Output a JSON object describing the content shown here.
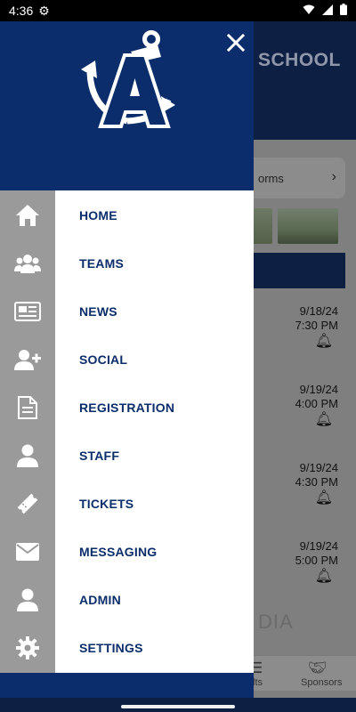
{
  "status_bar": {
    "time": "4:36"
  },
  "background": {
    "school_text": "SCHOOL",
    "forms_text": "orms",
    "events": [
      {
        "date": "9/18/24",
        "time": "7:30 PM"
      },
      {
        "date": "9/19/24",
        "time": "4:00 PM"
      },
      {
        "date": "9/19/24",
        "time": "4:30 PM"
      },
      {
        "date": "9/19/24",
        "time": "5:00 PM"
      }
    ],
    "media_text": "DIA",
    "tab_results_partial": "lts",
    "tab_sponsors": "Sponsors"
  },
  "menu": {
    "items": [
      {
        "label": "HOME",
        "icon": "home-icon"
      },
      {
        "label": "TEAMS",
        "icon": "group-icon"
      },
      {
        "label": "NEWS",
        "icon": "newspaper-icon"
      },
      {
        "label": "SOCIAL",
        "icon": "add-user-icon"
      },
      {
        "label": "REGISTRATION",
        "icon": "document-icon"
      },
      {
        "label": "STAFF",
        "icon": "person-icon"
      },
      {
        "label": "TICKETS",
        "icon": "ticket-icon"
      },
      {
        "label": "MESSAGING",
        "icon": "envelope-icon"
      },
      {
        "label": "ADMIN",
        "icon": "person-icon"
      },
      {
        "label": "SETTINGS",
        "icon": "gear-icon"
      }
    ]
  },
  "colors": {
    "brand_navy": "#0b2d6b",
    "menu_text": "#0b2d6b",
    "side_gray": "#9a9a9a"
  }
}
